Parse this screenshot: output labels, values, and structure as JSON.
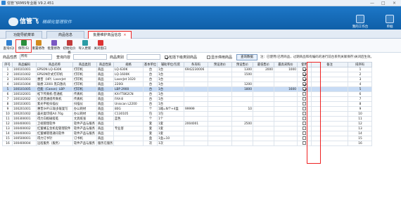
{
  "app": {
    "title": "信管飞RMIS专业版 V9.2.451",
    "min": "—",
    "max": "□",
    "close": "×"
  },
  "header": {
    "brand": "信管飞",
    "slogan": "精细化管理软件",
    "tools": [
      "我的工作台",
      "单据"
    ]
  },
  "tabs": [
    {
      "label": "功能导航菜单"
    },
    {
      "label": "商品信息"
    },
    {
      "label": "批量维护商品信息",
      "close": "×"
    }
  ],
  "toolbar": [
    {
      "label": "查询(Q)",
      "color": "#2f7fd0"
    },
    {
      "label": "保存(S)",
      "color": "#2a8f3d"
    },
    {
      "label": "重置修改",
      "color": "#d28a1f"
    },
    {
      "label": "批量修改",
      "color": "#7a58c2"
    },
    {
      "label": "初始化价格",
      "color": "#c23b3b"
    },
    {
      "label": "导入更新",
      "color": "#2b9ca5"
    },
    {
      "label": "关闭窗口",
      "color": "#d33"
    }
  ],
  "filter": {
    "type_label": "商品性质",
    "type_value": "所有",
    "code_label": "查询内容",
    "brand_label": "商品类别",
    "check1": "包括下级类别商品",
    "check2": "显示停用商品",
    "query_button": "查询数据",
    "note": "注：已使用(已用商品，过期商品和有编码的进行前台系列关联保存)关闭后生效。"
  },
  "columns": [
    "序号",
    "商品编码",
    "商品名称",
    "商品类别",
    "商品性质",
    "规格",
    "基本单位",
    "辅助单位/包装",
    "条形码",
    "预设进价",
    "预设售价",
    "最低售价",
    "最高采购价",
    "使用",
    "备注",
    "排序码"
  ],
  "rows": [
    [
      "1",
      "100101001",
      "EPSON LQ-630K",
      "打印机",
      "商品",
      "LQ-630K",
      "台",
      "1台",
      "6942230006",
      "",
      "1300",
      "2000",
      "1000",
      "1",
      "",
      "1"
    ],
    [
      "2",
      "100101002",
      "EPSON针式打印机",
      "打印机",
      "商品",
      "LQ-1600K",
      "台",
      "1台",
      "",
      "",
      "1500",
      "",
      "",
      "1",
      "",
      "2"
    ],
    [
      "3",
      "100101003",
      "惠普（HP）LaserJet",
      "打印机",
      "商品",
      "LaserJet 1020",
      "台",
      "1台",
      "",
      "",
      "",
      "",
      "",
      "1",
      "",
      "3"
    ],
    [
      "4",
      "100101004",
      "联想 2200i 黑白激光",
      "打印机",
      "商品",
      "2200i",
      "台",
      "1台",
      "",
      "",
      "1200",
      "",
      "",
      "1",
      "",
      "4"
    ],
    [
      "5",
      "100101005",
      "佳能（Canon）LBP",
      "打印机",
      "商品",
      "LBP 2900",
      "台",
      "1台",
      "",
      "",
      "1800",
      "",
      "1600",
      "1",
      "",
      "5"
    ],
    [
      "6",
      "100102001",
      "松下传真机-普通纸",
      "传真机",
      "商品",
      "KX-FT862CN",
      "台",
      "1台",
      "",
      "",
      "",
      "",
      "",
      "0",
      "",
      "6"
    ],
    [
      "7",
      "100102002",
      "兄弟普通纸传真机",
      "传真机",
      "商品",
      "FAX-8",
      "台",
      "1台",
      "",
      "",
      "",
      "",
      "",
      "0",
      "",
      "7"
    ],
    [
      "8",
      "100103001",
      "紫光平板扫描仪",
      "扫描仪",
      "商品",
      "Uniscan L2200",
      "台",
      "1台",
      "",
      "",
      "",
      "",
      "",
      "0",
      "",
      "8"
    ],
    [
      "9",
      "100201001",
      "惠普(HP)三联多联复写",
      "办公耗材",
      "商品",
      "80G",
      "个",
      "1箱=N个+4盒",
      "99999",
      "",
      "10",
      "",
      "",
      "0",
      "",
      "9"
    ],
    [
      "10",
      "100201002",
      "晨光复印纸A4 70g",
      "办公耗材",
      "商品",
      "C130105",
      "包",
      "1包",
      "",
      "",
      "",
      "",
      "",
      "0",
      "",
      "10"
    ],
    [
      "11",
      "100300001",
      "得力白板磁吸笔",
      "文具纸张",
      "商品",
      "蓝色",
      "个",
      "1个",
      "",
      "",
      "",
      "",
      "",
      "0",
      "",
      "11"
    ],
    [
      "12",
      "100400001",
      "卫视管理软件",
      "软件产品与服务",
      "商品",
      "",
      "套",
      "1套",
      "2004001",
      "",
      "2500",
      "",
      "",
      "0",
      "",
      "12"
    ],
    [
      "13",
      "100400002",
      "红蜜蜂五金机电管理软件",
      "软件产品与服务",
      "商品",
      "专业客",
      "套",
      "1套",
      "",
      "",
      "",
      "",
      "",
      "0",
      "",
      "13"
    ],
    [
      "14",
      "100400003",
      "红蜜蜂管理通讯软件",
      "软件产品与服务",
      "商品",
      "",
      "套",
      "1套",
      "",
      "",
      "",
      "",
      "",
      "0",
      "",
      "14"
    ],
    [
      "15",
      "100500001",
      "得力订书针",
      "订书机",
      "商品",
      "",
      "盒",
      "1盒=10",
      "",
      "",
      "",
      "",
      "",
      "0",
      "",
      "15"
    ],
    [
      "16",
      "100400004",
      "远程服务（服务）",
      "软件产品与服务",
      "服务在服务",
      "",
      "次",
      "1次",
      "",
      "",
      "",
      "",
      "",
      "0",
      "",
      "16"
    ]
  ]
}
